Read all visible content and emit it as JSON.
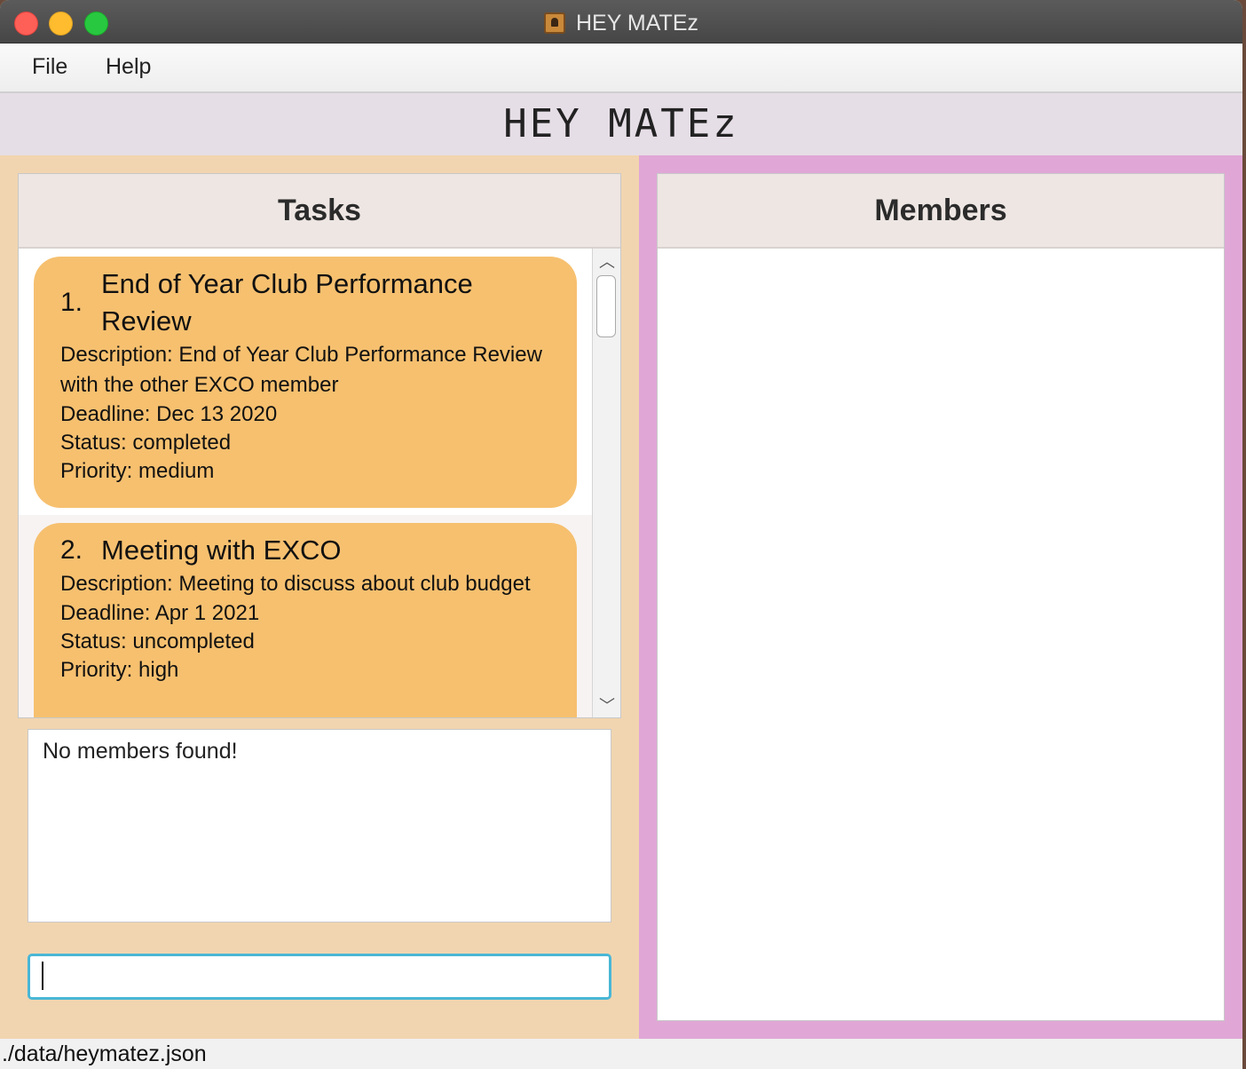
{
  "window": {
    "title": "HEY MATEz"
  },
  "menubar": {
    "items": [
      {
        "label": "File"
      },
      {
        "label": "Help"
      }
    ]
  },
  "header": {
    "title": "HEY MATEz"
  },
  "tasks": {
    "heading": "Tasks",
    "items": [
      {
        "index": "1.",
        "title": "End of Year Club Performance Review",
        "description": "Description: End of Year Club Performance Review with the other EXCO member",
        "deadline": "Deadline: Dec 13 2020",
        "status": "Status: completed",
        "priority": "Priority: medium"
      },
      {
        "index": "2.",
        "title": "Meeting with EXCO",
        "description": "Description: Meeting to discuss about club budget",
        "deadline": "Deadline: Apr 1 2021",
        "status": "Status: uncompleted",
        "priority": "Priority: high"
      }
    ]
  },
  "result": {
    "text": "No members found!"
  },
  "command": {
    "value": ""
  },
  "members": {
    "heading": "Members"
  },
  "statusbar": {
    "path": "./data/heymatez.json"
  },
  "colors": {
    "left_bg": "#f1d5b0",
    "right_bg": "#e0a7d6",
    "task_card": "#f6c06f",
    "header_bg": "#e6dee6",
    "focus_border": "#49b7d6"
  }
}
